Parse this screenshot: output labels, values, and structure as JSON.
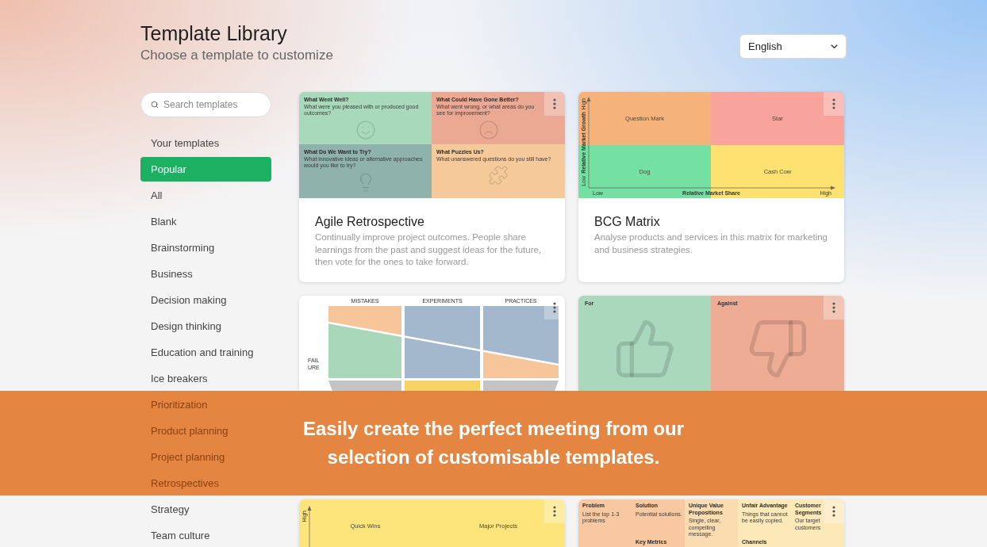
{
  "header": {
    "title": "Template Library",
    "subtitle": "Choose a template to customize"
  },
  "language_select": {
    "value": "English"
  },
  "search": {
    "placeholder": "Search templates"
  },
  "sidebar": {
    "items": [
      {
        "label": "Your templates",
        "selected": false
      },
      {
        "label": "Popular",
        "selected": true
      },
      {
        "label": "All",
        "selected": false
      },
      {
        "label": "Blank",
        "selected": false
      },
      {
        "label": "Brainstorming",
        "selected": false
      },
      {
        "label": "Business",
        "selected": false
      },
      {
        "label": "Decision making",
        "selected": false
      },
      {
        "label": "Design thinking",
        "selected": false
      },
      {
        "label": "Education and training",
        "selected": false
      },
      {
        "label": "Ice breakers",
        "selected": false
      },
      {
        "label": "Prioritization",
        "selected": false
      },
      {
        "label": "Product planning",
        "selected": false
      },
      {
        "label": "Project planning",
        "selected": false
      },
      {
        "label": "Retrospectives",
        "selected": false
      },
      {
        "label": "Strategy",
        "selected": false
      },
      {
        "label": "Team culture",
        "selected": false
      }
    ]
  },
  "templates": [
    {
      "kind": "quadrant_notes",
      "title": "Agile Retrospective",
      "description": "Continually improve project outcomes. People share learnings from the past and suggest ideas for the future, then vote for the ones to take forward.",
      "preview": {
        "cells": [
          {
            "heading": "What Went Well?",
            "text": "What were you pleased with or produced good outcomes?"
          },
          {
            "heading": "What Could Have Gone Better?",
            "text": "What went wrong, or what areas do you see for improvement?"
          },
          {
            "heading": "What Do We Want to Try?",
            "text": "What innovative ideas or alternative approaches would you like to try?"
          },
          {
            "heading": "What Puzzles Us?",
            "text": "What unanswered questions do you still have?"
          }
        ]
      }
    },
    {
      "kind": "growth_share_matrix",
      "title": "BCG Matrix",
      "description": "Analyse products and services in this matrix for marketing and business strategies.",
      "preview": {
        "quadrants": [
          "Question Mark",
          "Star",
          "Dog",
          "Cash Cow"
        ],
        "y_axis": {
          "high": "High",
          "label": "Relative Market Growth",
          "low": "Low"
        },
        "x_axis": {
          "low": "Low",
          "label": "Relative Market Share",
          "high": "High"
        }
      }
    },
    {
      "kind": "sloped_columns",
      "preview": {
        "columns": [
          "MISTAKES",
          "EXPERIMENTS",
          "PRACTICES"
        ],
        "row_label": "FAILURE"
      }
    },
    {
      "kind": "two_columns",
      "preview": {
        "columns": [
          "For",
          "Against"
        ]
      }
    },
    {
      "kind": "priority_matrix",
      "preview": {
        "y_axis_high": "High",
        "quadrants": [
          "Quick Wins",
          "Major Projects"
        ]
      }
    },
    {
      "kind": "lean_canvas",
      "preview": {
        "blocks": [
          {
            "heading": "Problem",
            "text": "List the top 1-3 problems"
          },
          {
            "heading": "Solution",
            "text": "Potential solutions."
          },
          {
            "heading": "Unique Value Propositions",
            "text": "Single, clear, compelling message."
          },
          {
            "heading": "Unfair Advantage",
            "text": "Things that cannot be easily copied."
          },
          {
            "heading": "Customer Segments",
            "text": "Our target customers"
          },
          {
            "heading": "Key Metrics"
          },
          {
            "heading": "Channels"
          }
        ]
      }
    }
  ],
  "banner": {
    "text": "Easily create the perfect meeting from our selection of customisable templates."
  }
}
